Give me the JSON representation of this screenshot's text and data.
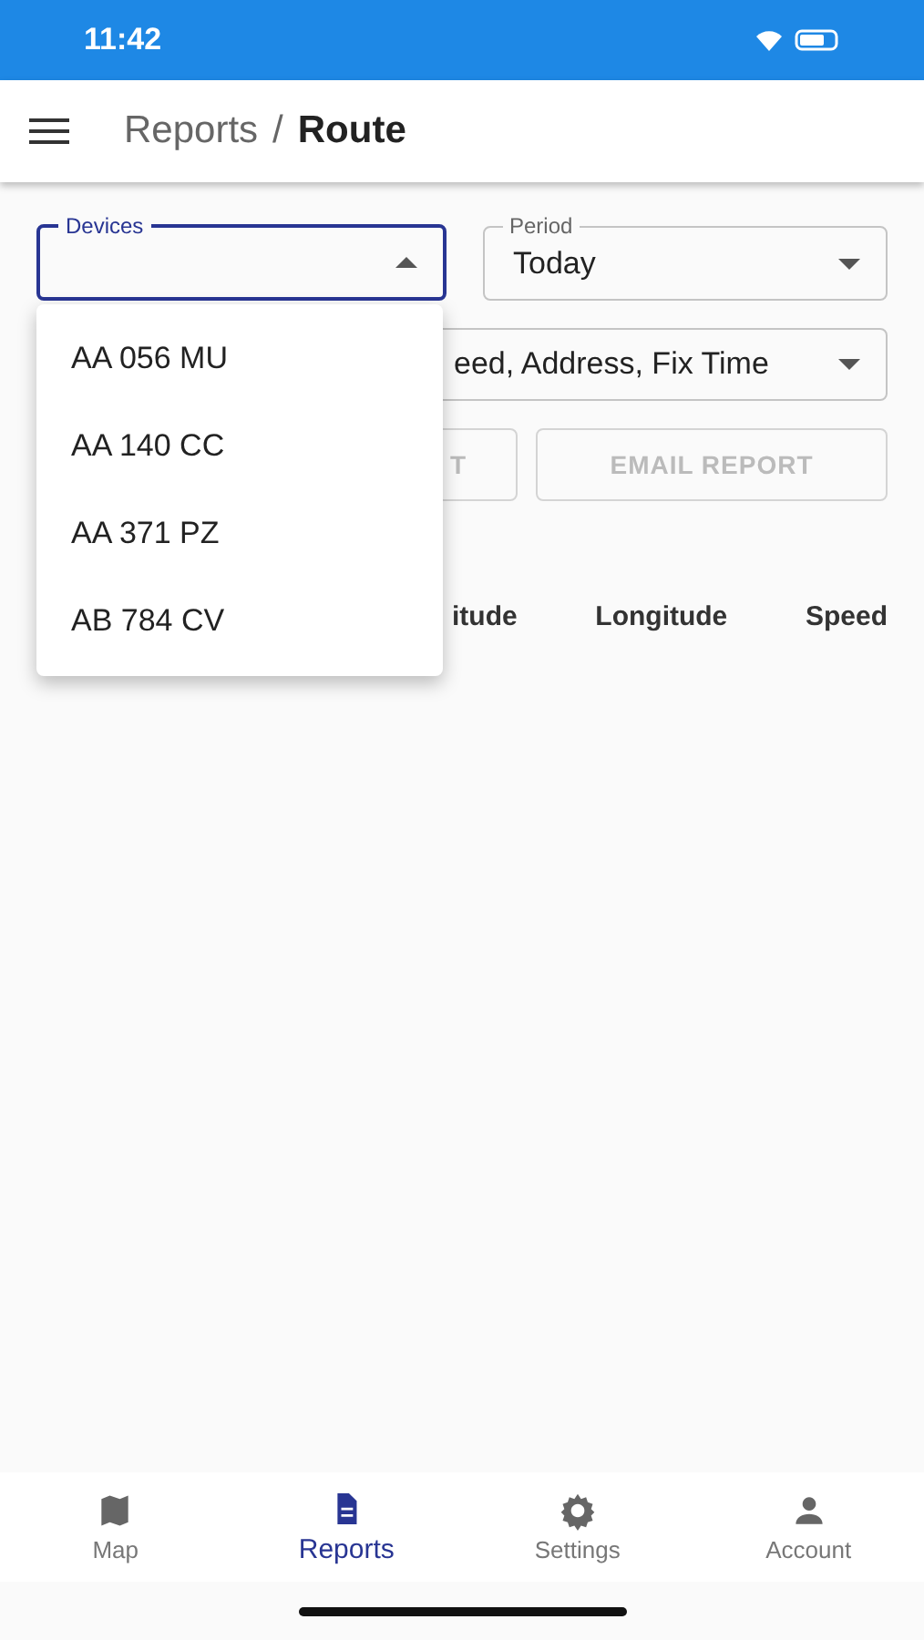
{
  "status_bar": {
    "time": "11:42"
  },
  "app_bar": {
    "parent": "Reports",
    "separator": "/",
    "title": "Route"
  },
  "devices_field": {
    "label": "Devices",
    "expanded": true
  },
  "period_field": {
    "label": "Period",
    "value": "Today"
  },
  "columns_field": {
    "value": "eed, Address, Fix Time"
  },
  "buttons": [
    {
      "label": "T"
    },
    {
      "label": "EMAIL REPORT"
    }
  ],
  "table": {
    "columns": [
      "itude",
      "Longitude",
      "Speed"
    ]
  },
  "device_menu": [
    {
      "label": "AA 056 MU"
    },
    {
      "label": "AA 140 CC"
    },
    {
      "label": "AA 371 PZ"
    },
    {
      "label": "AB 784 CV"
    }
  ],
  "bottom_nav": [
    {
      "label": "Map",
      "kind": "map",
      "selected": false
    },
    {
      "label": "Reports",
      "kind": "reports",
      "selected": true
    },
    {
      "label": "Settings",
      "kind": "settings",
      "selected": false
    },
    {
      "label": "Account",
      "kind": "account",
      "selected": false
    }
  ]
}
